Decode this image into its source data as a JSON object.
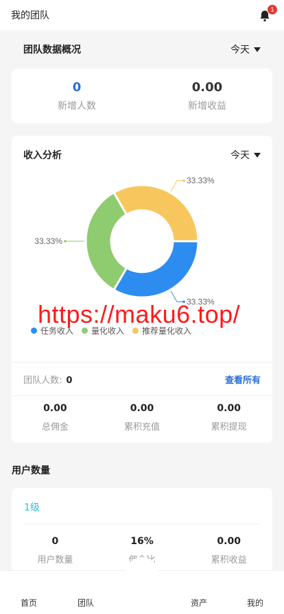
{
  "header": {
    "title": "我的团队",
    "notification_count": "1"
  },
  "overview": {
    "title": "团队数据概况",
    "filter": "今天",
    "new_members_value": "0",
    "new_members_label": "新增人数",
    "new_income_value": "0.00",
    "new_income_label": "新增收益"
  },
  "income": {
    "title": "收入分析",
    "filter": "今天",
    "watermark": "https://maku6.top/",
    "legend": [
      "任务收入",
      "量化收入",
      "推荐量化收入"
    ],
    "team_members_label": "团队人数:",
    "team_members_value": "0",
    "view_all": "查看所有",
    "stats": [
      {
        "value": "0.00",
        "label": "总佣金"
      },
      {
        "value": "0.00",
        "label": "累积充值"
      },
      {
        "value": "0.00",
        "label": "累积提现"
      }
    ]
  },
  "chart_data": {
    "type": "pie",
    "categories": [
      "任务收入",
      "量化收入",
      "推荐量化收入"
    ],
    "values": [
      33.33,
      33.33,
      33.33
    ],
    "colors": [
      "#2d8cf0",
      "#8fcb6f",
      "#f7c65d"
    ],
    "data_labels": [
      "33.33%",
      "33.33%",
      "33.33%"
    ],
    "donut": true
  },
  "users": {
    "title": "用户数量",
    "level": "1级",
    "stats": [
      {
        "value": "0",
        "label": "用户数量"
      },
      {
        "value": "16%",
        "label": "佣金比"
      },
      {
        "value": "0.00",
        "label": "累积收益"
      }
    ]
  },
  "tabbar": {
    "home": "首页",
    "team": "团队",
    "assets": "资产",
    "mine": "我的"
  }
}
